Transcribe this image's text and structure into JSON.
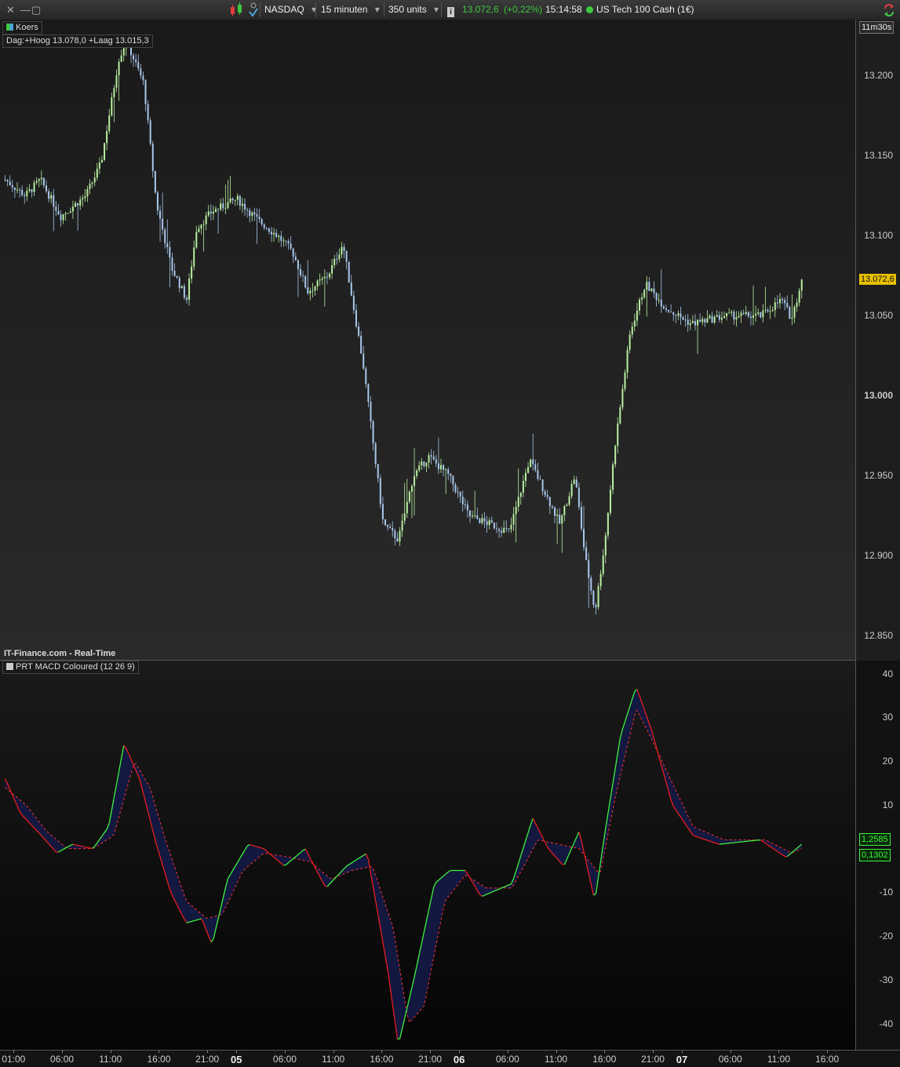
{
  "toolbar": {
    "instrument": "NASDAQ",
    "timeframe": "15 minuten",
    "units": "350 units",
    "quote_price": "13.072,6",
    "quote_change": "(+0,22%)",
    "quote_time": "15:14:58",
    "quote_name": "US Tech 100 Cash (1€)",
    "close_glyph": "✕",
    "minimize_glyph": "—",
    "maximize_glyph": "▢",
    "dropdown_glyph": "▾",
    "info_glyph": "i"
  },
  "colors": {
    "bull_candle": "#b8f0a0",
    "bear_candle": "#a8c8ec",
    "macd_up": "#3df23d",
    "macd_down": "#e81d1d",
    "signal": "#ee3030",
    "quote_green": "#3ec93e",
    "last_price_bg": "#e8c000"
  },
  "panels": {
    "main_legend": "Koers",
    "main_info": "Dag:+Hoog 13.078,0 +Laag 13.015,3",
    "countdown": "11m30s",
    "watermark": "IT-Finance.com - Real-Time",
    "indicator_legend": "PRT MACD Coloured (12 26 9)"
  },
  "chart_data": [
    {
      "type": "candlestick",
      "title": "",
      "y_ticks": [
        "13.200",
        "13.150",
        "13.100",
        "13.050",
        "13.000",
        "12.950",
        "12.900",
        "12.850"
      ],
      "y_tick_values": [
        13200,
        13150,
        13100,
        13050,
        13000,
        12950,
        12900,
        12850
      ],
      "ylim": [
        12835,
        13235
      ],
      "last_price": 13072.6,
      "last_price_label": "13.072,6",
      "price_path_keypoints": [
        [
          0,
          13135
        ],
        [
          8,
          13125
        ],
        [
          14,
          13135
        ],
        [
          22,
          13112
        ],
        [
          32,
          13125
        ],
        [
          38,
          13145
        ],
        [
          45,
          13210
        ],
        [
          48,
          13222
        ],
        [
          55,
          13195
        ],
        [
          60,
          13120
        ],
        [
          66,
          13080
        ],
        [
          72,
          13060
        ],
        [
          76,
          13105
        ],
        [
          82,
          13115
        ],
        [
          92,
          13123
        ],
        [
          100,
          13110
        ],
        [
          108,
          13100
        ],
        [
          114,
          13090
        ],
        [
          120,
          13065
        ],
        [
          128,
          13075
        ],
        [
          134,
          13095
        ],
        [
          142,
          13020
        ],
        [
          150,
          12920
        ],
        [
          156,
          12910
        ],
        [
          162,
          12950
        ],
        [
          168,
          12962
        ],
        [
          176,
          12950
        ],
        [
          184,
          12925
        ],
        [
          192,
          12920
        ],
        [
          200,
          12915
        ],
        [
          208,
          12960
        ],
        [
          214,
          12940
        ],
        [
          220,
          12920
        ],
        [
          226,
          12950
        ],
        [
          230,
          12900
        ],
        [
          234,
          12865
        ],
        [
          238,
          12910
        ],
        [
          242,
          12970
        ],
        [
          248,
          13040
        ],
        [
          254,
          13070
        ],
        [
          262,
          13055
        ],
        [
          272,
          13045
        ],
        [
          286,
          13050
        ],
        [
          300,
          13050
        ],
        [
          308,
          13060
        ],
        [
          312,
          13048
        ],
        [
          316,
          13072
        ]
      ]
    },
    {
      "type": "line",
      "title": "",
      "y_ticks": [
        "40",
        "30",
        "20",
        "10",
        "-10",
        "-20",
        "-30",
        "-40"
      ],
      "y_tick_values": [
        40,
        30,
        20,
        10,
        -10,
        -20,
        -30,
        -40
      ],
      "ylim": [
        -46,
        43
      ],
      "last_macd_label": "1,2585",
      "last_signal_label": "0,1302",
      "series": [
        {
          "values": [
            [
              0,
              16
            ],
            [
              6,
              8
            ],
            [
              14,
              3
            ],
            [
              20,
              -1
            ],
            [
              26,
              1
            ],
            [
              34,
              0
            ],
            [
              40,
              5
            ],
            [
              46,
              24
            ],
            [
              52,
              16
            ],
            [
              58,
              2
            ],
            [
              64,
              -10
            ],
            [
              70,
              -17
            ],
            [
              76,
              -16
            ],
            [
              80,
              -22
            ],
            [
              86,
              -7
            ],
            [
              94,
              1
            ],
            [
              100,
              0
            ],
            [
              108,
              -4
            ],
            [
              116,
              0
            ],
            [
              124,
              -9
            ],
            [
              132,
              -4
            ],
            [
              140,
              -1
            ],
            [
              148,
              -28
            ],
            [
              152,
              -45
            ],
            [
              158,
              -30
            ],
            [
              166,
              -8
            ],
            [
              172,
              -5
            ],
            [
              178,
              -5
            ],
            [
              184,
              -11
            ],
            [
              196,
              -8
            ],
            [
              204,
              7
            ],
            [
              210,
              0
            ],
            [
              216,
              -4
            ],
            [
              222,
              4
            ],
            [
              228,
              -12
            ],
            [
              232,
              4
            ],
            [
              238,
              26
            ],
            [
              244,
              37
            ],
            [
              250,
              27
            ],
            [
              258,
              10
            ],
            [
              266,
              3
            ],
            [
              276,
              1
            ],
            [
              292,
              2
            ],
            [
              302,
              -2
            ],
            [
              308,
              1
            ]
          ]
        },
        {
          "values": [
            [
              0,
              14
            ],
            [
              8,
              10
            ],
            [
              16,
              4
            ],
            [
              24,
              0
            ],
            [
              34,
              0
            ],
            [
              42,
              3
            ],
            [
              50,
              20
            ],
            [
              56,
              14
            ],
            [
              62,
              2
            ],
            [
              70,
              -12
            ],
            [
              78,
              -16
            ],
            [
              84,
              -15
            ],
            [
              92,
              -5
            ],
            [
              100,
              -1
            ],
            [
              110,
              -2
            ],
            [
              118,
              -3
            ],
            [
              126,
              -7
            ],
            [
              134,
              -5
            ],
            [
              142,
              -4
            ],
            [
              150,
              -18
            ],
            [
              156,
              -40
            ],
            [
              162,
              -36
            ],
            [
              170,
              -12
            ],
            [
              178,
              -6
            ],
            [
              186,
              -9
            ],
            [
              196,
              -9
            ],
            [
              206,
              2
            ],
            [
              214,
              1
            ],
            [
              222,
              0
            ],
            [
              230,
              -6
            ],
            [
              236,
              12
            ],
            [
              244,
              32
            ],
            [
              250,
              25
            ],
            [
              258,
              15
            ],
            [
              266,
              5
            ],
            [
              278,
              2
            ],
            [
              294,
              2
            ],
            [
              304,
              -1
            ],
            [
              308,
              0
            ]
          ]
        }
      ]
    }
  ],
  "time_axis": {
    "labels": [
      "01:00",
      "06:00",
      "11:00",
      "16:00",
      "21:00",
      "05",
      "06:00",
      "11:00",
      "16:00",
      "21:00",
      "06",
      "06:00",
      "11:00",
      "16:00",
      "21:00",
      "07",
      "06:00",
      "11:00",
      "16:00"
    ],
    "bar_index": [
      4,
      24,
      44,
      64,
      84,
      96,
      116,
      136,
      156,
      176,
      188,
      208,
      228,
      248,
      268,
      280,
      300,
      320,
      340
    ],
    "day_markers": [
      "05",
      "06",
      "07"
    ],
    "bar_count": 350
  }
}
